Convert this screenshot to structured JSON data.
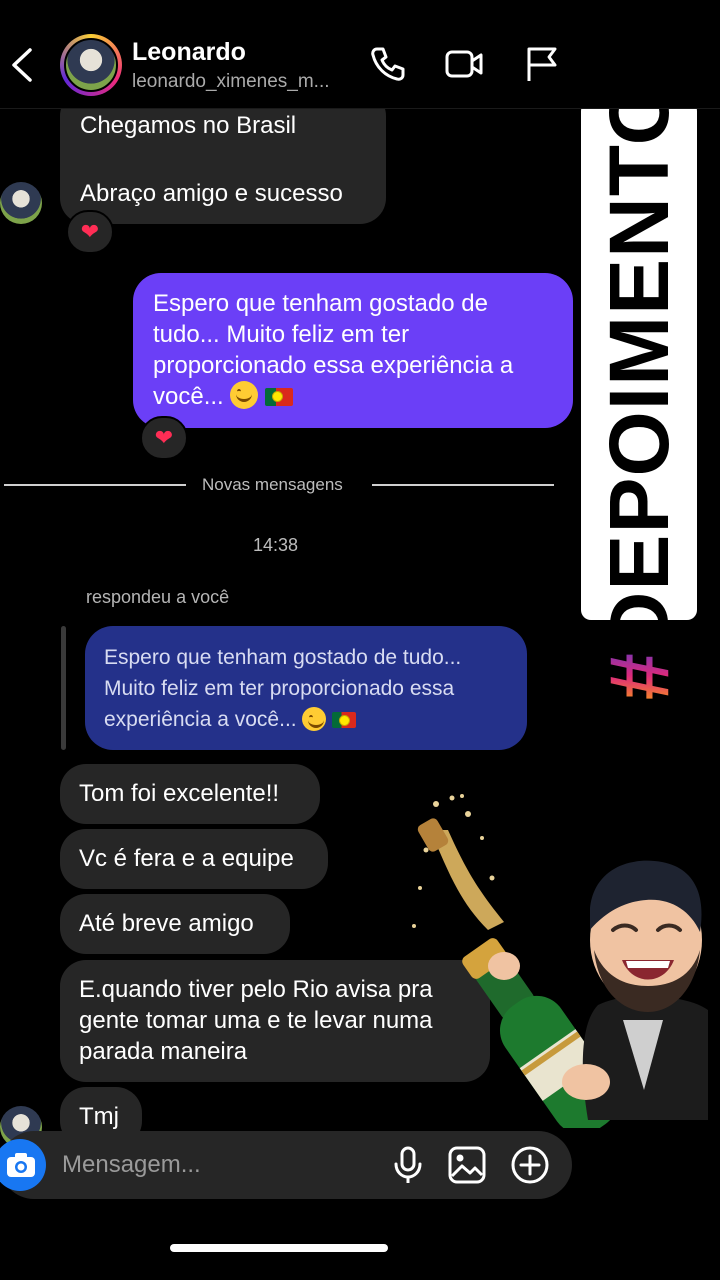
{
  "header": {
    "name": "Leonardo",
    "handle": "leonardo_ximenes_m..."
  },
  "messages": {
    "top_partial": "Chegamos no Brasil",
    "top_closing": "Abraço amigo e sucesso",
    "top_reaction": "❤",
    "sent_text": "Espero que tenham gostado de tudo... Muito feliz em ter proporcionado essa experiência a você...",
    "sent_reaction": "❤",
    "divider_label": "Novas mensagens",
    "timestamp": "14:38",
    "replied_label": "respondeu a você",
    "quoted_text": "Espero que tenham gostado de tudo... Muito feliz em ter proporcionado essa experiência a você...",
    "received": [
      "Tom foi excelente!!",
      "Vc é fera e a equipe",
      "Até breve amigo",
      "E.quando tiver pelo Rio avisa pra gente tomar uma e te levar numa parada maneira",
      "Tmj"
    ]
  },
  "sticker": {
    "hash": "#",
    "word": "DEPOIMENTOS"
  },
  "composer": {
    "placeholder": "Mensagem..."
  },
  "icons": [
    "back-arrow-icon",
    "phone-icon",
    "video-icon",
    "flag-icon",
    "camera-icon",
    "microphone-icon",
    "gallery-icon",
    "plus-circle-icon"
  ],
  "colors": {
    "sent_bubble": "#6b3ff7",
    "received_bubble": "#262626",
    "quoted_bubble": "#24318a",
    "camera_button": "#1877f2"
  }
}
